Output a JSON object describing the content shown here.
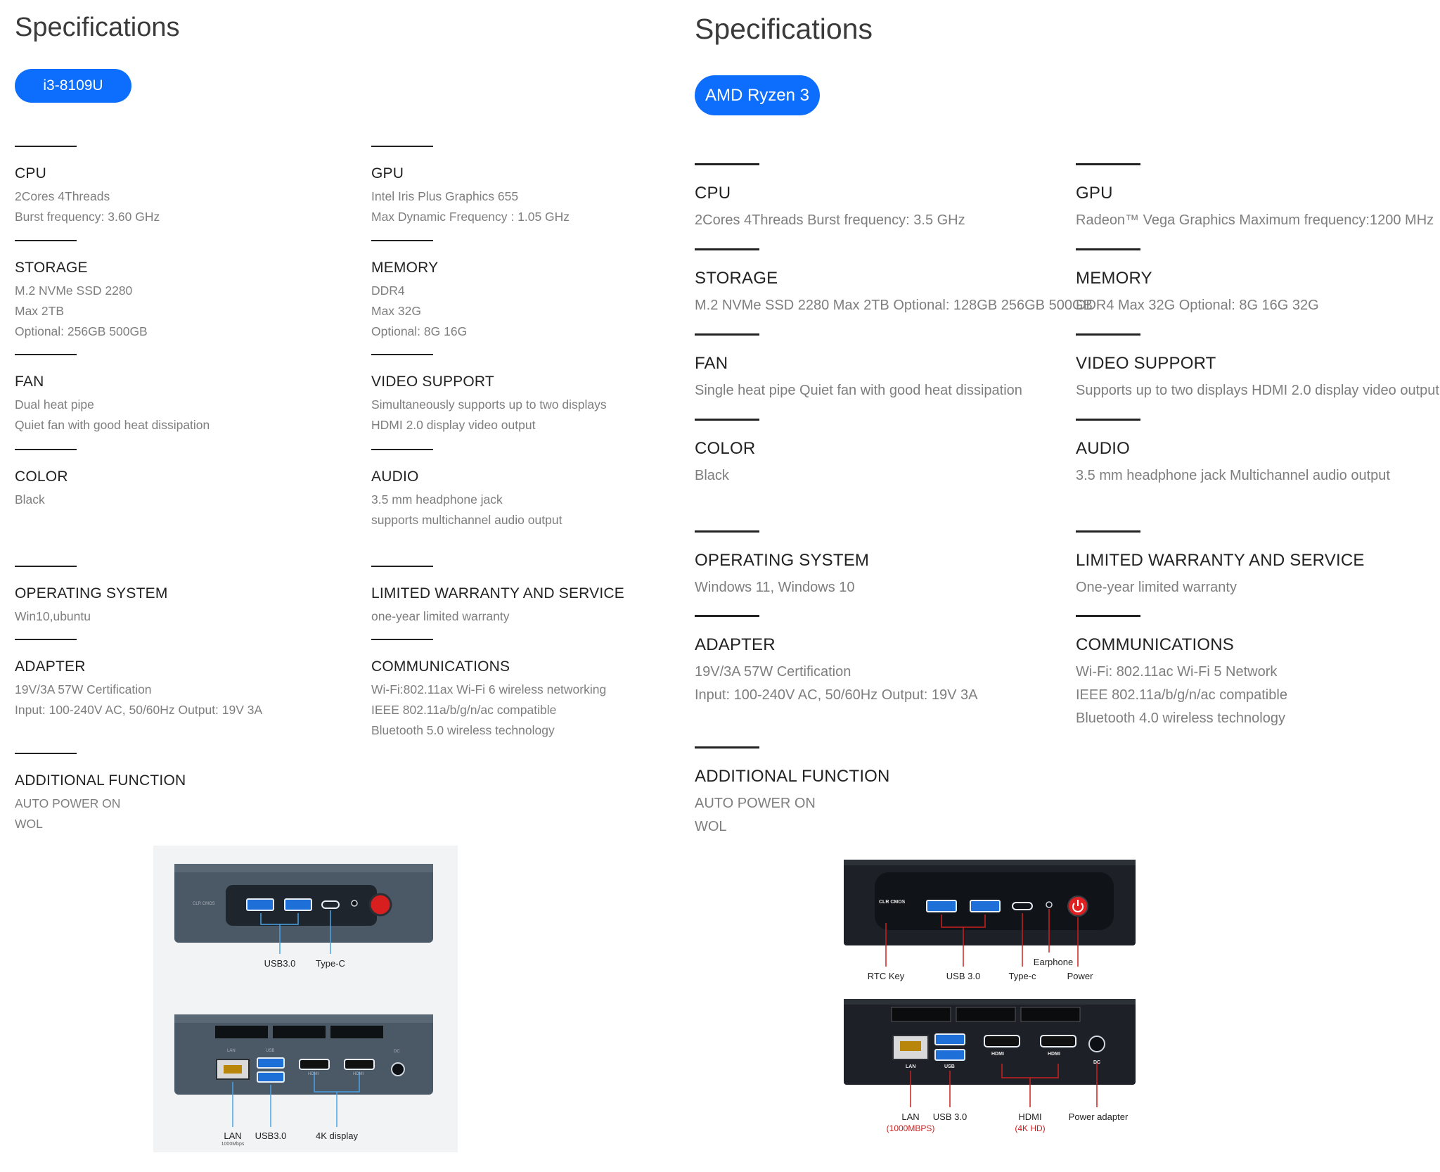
{
  "left": {
    "title": "Specifications",
    "model": "i3-8109U",
    "specs": {
      "cpu": {
        "label": "CPU",
        "lines": [
          "2Cores 4Threads",
          "Burst frequency: 3.60 GHz"
        ]
      },
      "gpu": {
        "label": "GPU",
        "lines": [
          "Intel Iris Plus Graphics 655",
          "Max Dynamic Frequency : 1.05 GHz"
        ]
      },
      "storage": {
        "label": "STORAGE",
        "lines": [
          "M.2 NVMe SSD 2280",
          "Max 2TB",
          "Optional: 256GB 500GB"
        ]
      },
      "memory": {
        "label": "MEMORY",
        "lines": [
          "DDR4",
          "Max 32G",
          "Optional: 8G 16G"
        ]
      },
      "fan": {
        "label": "FAN",
        "lines": [
          "Dual heat pipe",
          "Quiet fan with good heat dissipation"
        ]
      },
      "video": {
        "label": "VIDEO SUPPORT",
        "lines": [
          "Simultaneously supports up to two displays",
          "HDMI 2.0 display video output"
        ]
      },
      "color": {
        "label": "COLOR",
        "lines": [
          "Black"
        ]
      },
      "audio": {
        "label": "AUDIO",
        "lines": [
          "3.5 mm headphone jack",
          "supports multichannel audio output"
        ]
      },
      "os": {
        "label": "OPERATING SYSTEM",
        "lines": [
          "Win10,ubuntu"
        ]
      },
      "warranty": {
        "label": "LIMITED WARRANTY AND SERVICE",
        "lines": [
          "one-year limited warranty"
        ]
      },
      "adapter": {
        "label": "ADAPTER",
        "lines": [
          "19V/3A 57W Certification",
          "Input: 100-240V AC, 50/60Hz Output: 19V 3A"
        ]
      },
      "comms": {
        "label": "COMMUNICATIONS",
        "lines": [
          "Wi-Fi:802.11ax Wi-Fi 6 wireless networking",
          "IEEE 802.11a/b/g/n/ac compatible",
          "Bluetooth 5.0 wireless technology"
        ]
      },
      "additional": {
        "label": "ADDITIONAL FUNCTION",
        "lines": [
          "AUTO POWER ON",
          "WOL"
        ]
      }
    },
    "front": {
      "usb": "USB3.0",
      "typec": "Type-C",
      "clr_cmos": "CLR CMOS"
    },
    "back": {
      "lan": "LAN",
      "lan_speed": "1000Mbps",
      "usb": "USB3.0",
      "display": "4K display",
      "lan_port": "LAN",
      "usb_port": "USB",
      "hdmi_port": "HDMI",
      "dc_port": "DC"
    }
  },
  "right": {
    "title": "Specifications",
    "model": "AMD Ryzen 3",
    "specs": {
      "cpu": {
        "label": "CPU",
        "lines": [
          "2Cores 4Threads Burst frequency: 3.5 GHz"
        ]
      },
      "gpu": {
        "label": "GPU",
        "lines": [
          "Radeon™ Vega Graphics Maximum frequency:1200 MHz"
        ]
      },
      "storage": {
        "label": "STORAGE",
        "lines": [
          "M.2 NVMe SSD 2280 Max 2TB Optional: 128GB 256GB 500GB"
        ]
      },
      "memory": {
        "label": "MEMORY",
        "lines": [
          "DDR4 Max 32G Optional: 8G 16G 32G"
        ]
      },
      "fan": {
        "label": "FAN",
        "lines": [
          "Single heat pipe Quiet fan with good heat dissipation"
        ]
      },
      "video": {
        "label": "VIDEO SUPPORT",
        "lines": [
          "Supports up to two displays HDMI 2.0 display video output"
        ]
      },
      "color": {
        "label": "COLOR",
        "lines": [
          "Black"
        ]
      },
      "audio": {
        "label": "AUDIO",
        "lines": [
          "3.5 mm headphone jack Multichannel audio output"
        ]
      },
      "os": {
        "label": "OPERATING SYSTEM",
        "lines": [
          "Windows 11,  Windows 10"
        ]
      },
      "warranty": {
        "label": "LIMITED WARRANTY AND SERVICE",
        "lines": [
          "One-year limited warranty"
        ]
      },
      "adapter": {
        "label": "ADAPTER",
        "lines": [
          "19V/3A 57W Certification",
          "Input: 100-240V AC, 50/60Hz Output: 19V 3A"
        ]
      },
      "comms": {
        "label": "COMMUNICATIONS",
        "lines": [
          "Wi-Fi: 802.11ac Wi-Fi 5 Network",
          "IEEE 802.11a/b/g/n/ac compatible",
          "Bluetooth 4.0 wireless technology"
        ]
      },
      "additional": {
        "label": "ADDITIONAL FUNCTION",
        "lines": [
          "AUTO POWER ON",
          "WOL"
        ]
      }
    },
    "front": {
      "rtc": "RTC Key",
      "usb": "USB 3.0",
      "typec": "Type-c",
      "earphone": "Earphone",
      "power": "Power",
      "clr_cmos": "CLR CMOS"
    },
    "back": {
      "lan": "LAN",
      "lan_speed": "(1000MBPS)",
      "usb": "USB 3.0",
      "hdmi": "HDMI",
      "hdmi_res": "(4K HD)",
      "adapter": "Power adapter",
      "lan_port": "LAN",
      "usb_port": "USB",
      "hdmi_logo": "HDMI",
      "dc_port": "DC"
    }
  },
  "colors": {
    "accent": "#0d6efd",
    "label": "#222222",
    "value": "#7e7e7e",
    "callout_red": "#cc1f1f",
    "power_red": "#e02020"
  }
}
